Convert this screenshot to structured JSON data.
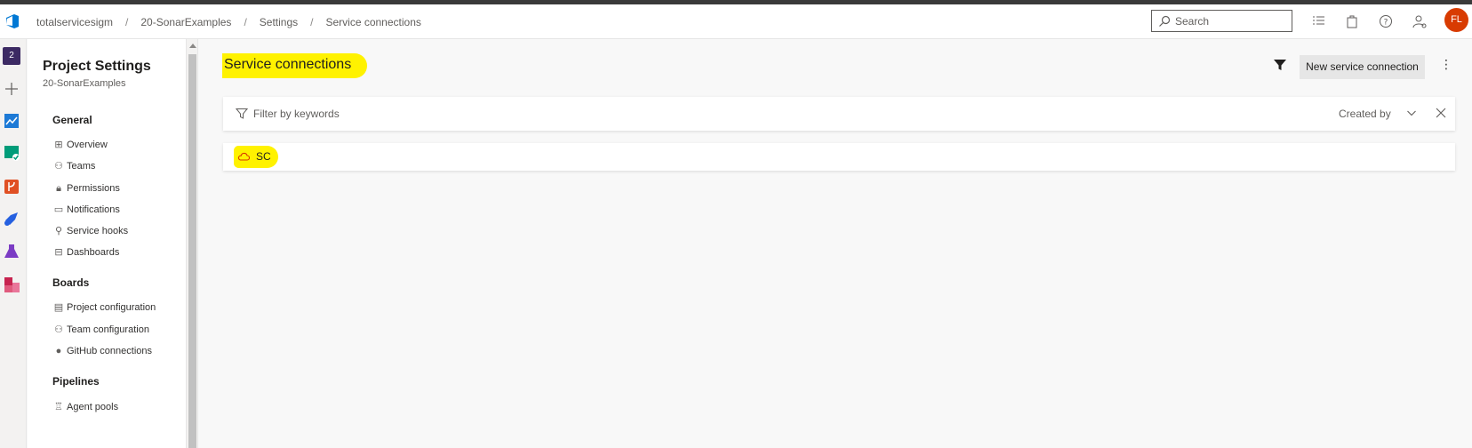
{
  "breadcrumb": [
    "totalservicesigm",
    "20-SonarExamples",
    "Settings",
    "Service connections"
  ],
  "search": {
    "placeholder": "Search"
  },
  "user": {
    "initials": "FL",
    "avatar_color": "#d83b01"
  },
  "rail": {
    "badge": "2"
  },
  "sidebar": {
    "title": "Project Settings",
    "subtitle": "20-SonarExamples",
    "groups": [
      {
        "label": "General",
        "items": [
          "Overview",
          "Teams",
          "Permissions",
          "Notifications",
          "Service hooks",
          "Dashboards"
        ]
      },
      {
        "label": "Boards",
        "items": [
          "Project configuration",
          "Team configuration",
          "GitHub connections"
        ]
      },
      {
        "label": "Pipelines",
        "items": [
          "Agent pools"
        ]
      }
    ]
  },
  "main": {
    "title": "Service connections",
    "new_button": "New service connection",
    "filter": {
      "placeholder": "Filter by keywords",
      "created_by": "Created by"
    },
    "connections": [
      {
        "name": "SC",
        "icon": "cloud-icon"
      }
    ]
  },
  "colors": {
    "highlight": "#fff200",
    "accent": "#0078d4"
  }
}
